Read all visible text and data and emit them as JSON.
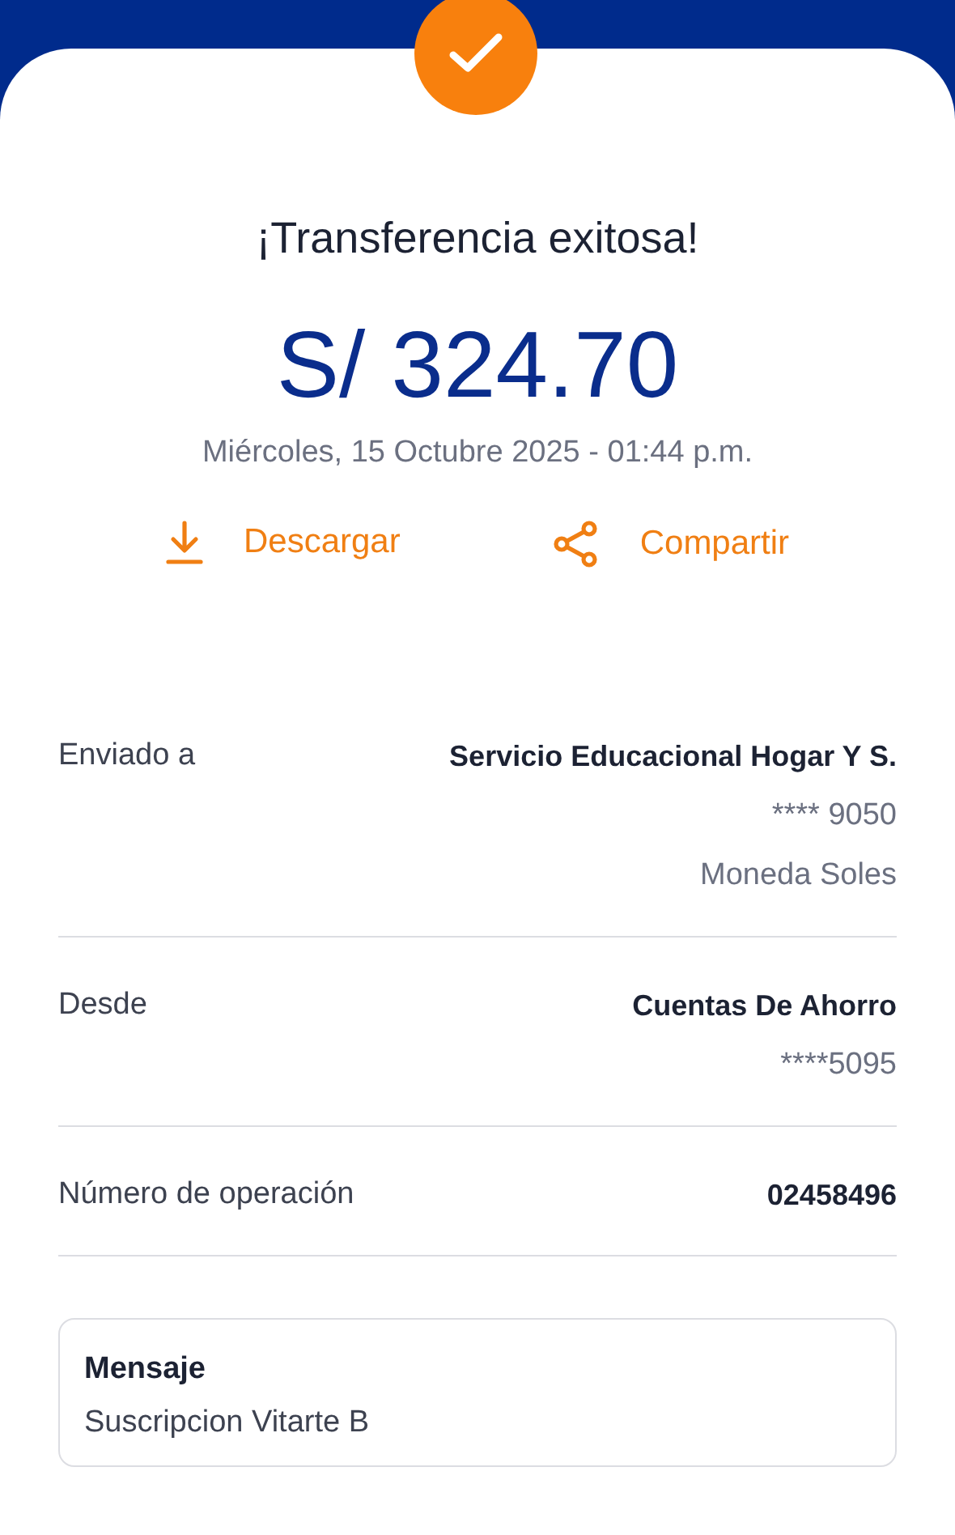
{
  "title": "¡Transferencia exitosa!",
  "amount": "S/ 324.70",
  "date": "Miércoles, 15 Octubre 2025 - 01:44 p.m.",
  "actions": [
    {
      "kind": "download",
      "label": "Descargar"
    },
    {
      "kind": "share",
      "label": "Compartir"
    }
  ],
  "details": [
    {
      "label": "Enviado a",
      "values": [
        "Servicio Educacional Hogar Y S.",
        "**** 9050",
        "Moneda Soles"
      ]
    },
    {
      "label": "Desde",
      "values": [
        "Cuentas De Ahorro",
        "****5095"
      ]
    },
    {
      "label": "Número de operación",
      "values": [
        "02458496"
      ]
    }
  ],
  "message": {
    "label": "Mensaje",
    "text": "Suscripcion Vitarte B"
  }
}
